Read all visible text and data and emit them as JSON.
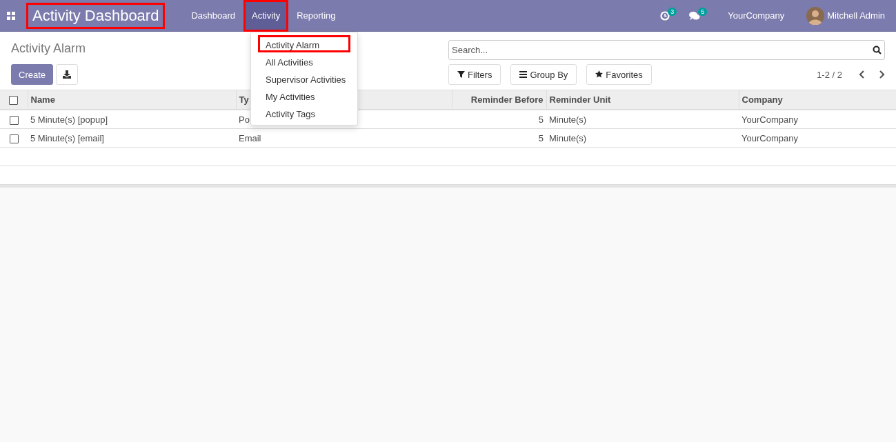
{
  "navbar": {
    "app_title": "Activity Dashboard",
    "app_title_highlighted": true,
    "menu": [
      {
        "label": "Dashboard",
        "selected": false,
        "highlighted": false
      },
      {
        "label": "Activity",
        "selected": true,
        "highlighted": true
      },
      {
        "label": "Reporting",
        "selected": false,
        "highlighted": false
      }
    ],
    "activity_count": "3",
    "message_count": "5",
    "company": "YourCompany",
    "user": "Mitchell Admin"
  },
  "dropdown": {
    "items": [
      {
        "label": "Activity Alarm",
        "highlighted": true
      },
      {
        "label": "All Activities",
        "highlighted": false
      },
      {
        "label": "Supervisor Activities",
        "highlighted": false
      },
      {
        "label": "My Activities",
        "highlighted": false
      },
      {
        "label": "Activity Tags",
        "highlighted": false
      }
    ]
  },
  "control_panel": {
    "breadcrumb": "Activity Alarm",
    "create_button": "Create",
    "search": {
      "placeholder": "Search..."
    },
    "filters": [
      {
        "kind": "filter",
        "label": "Filters"
      },
      {
        "kind": "group",
        "label": "Group By"
      },
      {
        "kind": "favorite",
        "label": "Favorites"
      }
    ],
    "pager": "1-2 / 2"
  },
  "table": {
    "all_checked": false,
    "columns": [
      {
        "label": "Name",
        "numeric": false
      },
      {
        "label": "Ty",
        "numeric": false
      },
      {
        "label": "Reminder Before",
        "numeric": true
      },
      {
        "label": "Reminder Unit",
        "numeric": false
      },
      {
        "label": "Company",
        "numeric": false
      }
    ],
    "rows": [
      {
        "checked": false,
        "cells": [
          "5 Minute(s) [popup]",
          "Po",
          "5",
          "Minute(s)",
          "YourCompany"
        ]
      },
      {
        "checked": false,
        "cells": [
          "5 Minute(s) [email]",
          "Email",
          "5",
          "Minute(s)",
          "YourCompany"
        ]
      }
    ]
  }
}
